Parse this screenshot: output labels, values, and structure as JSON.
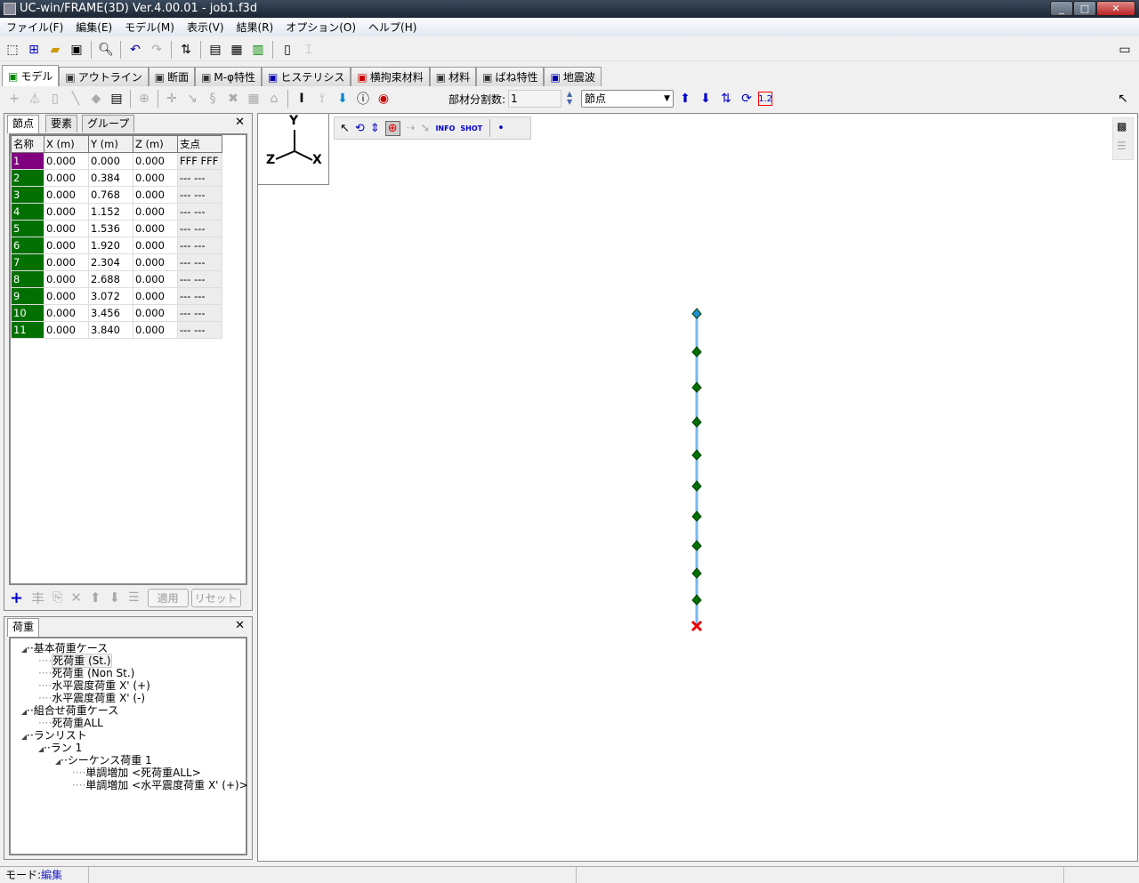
{
  "window": {
    "title": "UC-win/FRAME(3D) Ver.4.00.01 - job1.f3d"
  },
  "menu": [
    "ファイル(F)",
    "編集(E)",
    "モデル(M)",
    "表示(V)",
    "結果(R)",
    "オプション(O)",
    "ヘルプ(H)"
  ],
  "tabs": [
    {
      "label": "モデル",
      "icon": "model-icon"
    },
    {
      "label": "アウトライン",
      "icon": "outline-icon"
    },
    {
      "label": "断面",
      "icon": "section-icon"
    },
    {
      "label": "M-φ特性",
      "icon": "m-phi-icon"
    },
    {
      "label": "ヒステリシス",
      "icon": "hysteresis-icon"
    },
    {
      "label": "横拘束材料",
      "icon": "confinement-icon"
    },
    {
      "label": "材料",
      "icon": "material-icon"
    },
    {
      "label": "ばね特性",
      "icon": "spring-icon"
    },
    {
      "label": "地震波",
      "icon": "wave-icon"
    }
  ],
  "toolbar2": {
    "division_label": "部材分割数:",
    "division_value": "1",
    "select_value": "節点",
    "label_button": "1.2"
  },
  "node_panel": {
    "tabs": [
      "節点",
      "要素",
      "グループ"
    ],
    "columns": [
      "名称",
      "X (m)",
      "Y (m)",
      "Z (m)",
      "支点"
    ],
    "rows": [
      [
        "1",
        "0.000",
        "0.000",
        "0.000",
        "FFF FFF"
      ],
      [
        "2",
        "0.000",
        "0.384",
        "0.000",
        "--- ---"
      ],
      [
        "3",
        "0.000",
        "0.768",
        "0.000",
        "--- ---"
      ],
      [
        "4",
        "0.000",
        "1.152",
        "0.000",
        "--- ---"
      ],
      [
        "5",
        "0.000",
        "1.536",
        "0.000",
        "--- ---"
      ],
      [
        "6",
        "0.000",
        "1.920",
        "0.000",
        "--- ---"
      ],
      [
        "7",
        "0.000",
        "2.304",
        "0.000",
        "--- ---"
      ],
      [
        "8",
        "0.000",
        "2.688",
        "0.000",
        "--- ---"
      ],
      [
        "9",
        "0.000",
        "3.072",
        "0.000",
        "--- ---"
      ],
      [
        "10",
        "0.000",
        "3.456",
        "0.000",
        "--- ---"
      ],
      [
        "11",
        "0.000",
        "3.840",
        "0.000",
        "--- ---"
      ]
    ],
    "apply_label": "適用",
    "reset_label": "リセット"
  },
  "load_panel": {
    "tab": "荷重",
    "tree": [
      {
        "label": "基本荷重ケース",
        "level": 0
      },
      {
        "label": "死荷重 (St.)",
        "level": 1,
        "selected": true
      },
      {
        "label": "死荷重 (Non St.)",
        "level": 1
      },
      {
        "label": "水平震度荷重 X' (+)",
        "level": 1
      },
      {
        "label": "水平震度荷重 X' (-)",
        "level": 1
      },
      {
        "label": "組合せ荷重ケース",
        "level": 0
      },
      {
        "label": "死荷重ALL",
        "level": 1
      },
      {
        "label": "ランリスト",
        "level": 0
      },
      {
        "label": "ラン 1",
        "level": 1
      },
      {
        "label": "シーケンス荷重 1",
        "level": 2
      },
      {
        "label": "単調増加 <死荷重ALL>",
        "level": 3
      },
      {
        "label": "単調増加 <水平震度荷重 X' (+)>",
        "level": 3
      }
    ]
  },
  "view": {
    "axes": {
      "y": "Y",
      "z": "Z",
      "x": "X"
    },
    "toolbar": {
      "info": "INFO",
      "shot": "SHOT"
    }
  },
  "status": {
    "mode_label": "モード:",
    "mode_value": "編集"
  },
  "colors": {
    "node": "#007000",
    "selected_node": "#800080",
    "mode": "#2020c0"
  }
}
